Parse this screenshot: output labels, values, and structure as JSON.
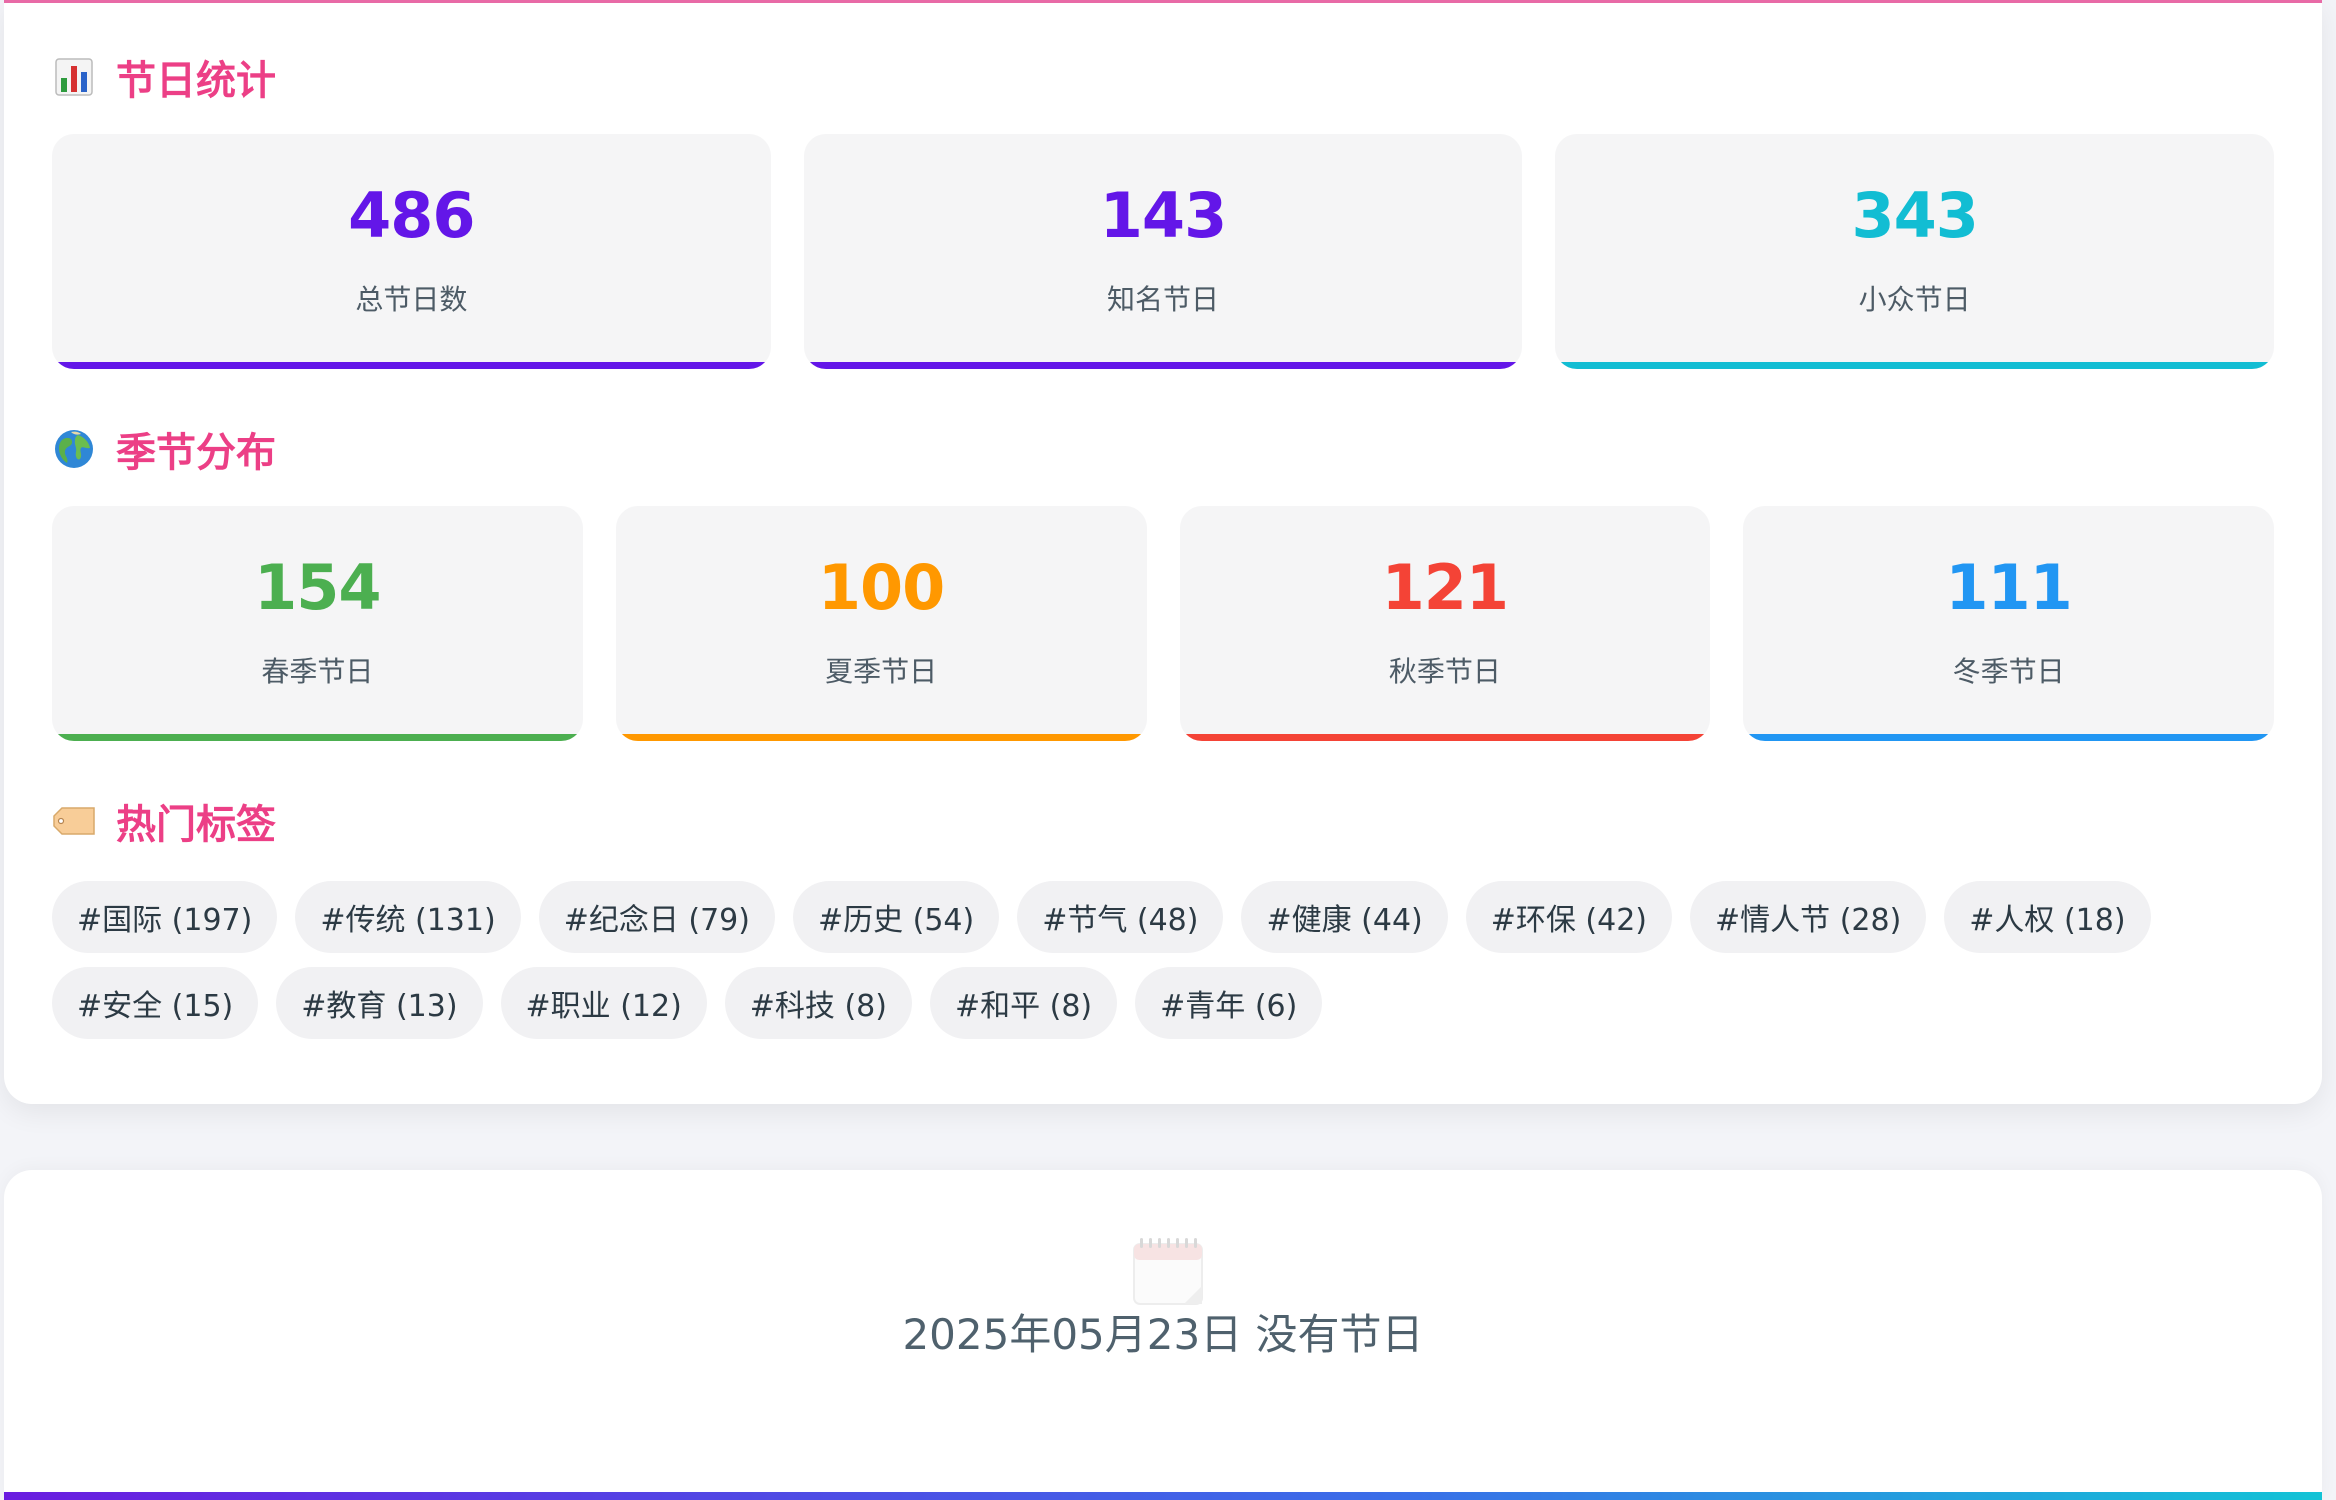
{
  "stats": {
    "title": "节日统计",
    "icon": "bar-chart-icon",
    "cards": [
      {
        "value": "486",
        "label": "总节日数",
        "color": "#6316e8"
      },
      {
        "value": "143",
        "label": "知名节日",
        "color": "#6316e8"
      },
      {
        "value": "343",
        "label": "小众节日",
        "color": "#12bdd3"
      }
    ]
  },
  "seasons": {
    "title": "季节分布",
    "icon": "globe-icon",
    "cards": [
      {
        "value": "154",
        "label": "春季节日",
        "color": "#4caf50"
      },
      {
        "value": "100",
        "label": "夏季节日",
        "color": "#ff9800"
      },
      {
        "value": "121",
        "label": "秋季节日",
        "color": "#f44336"
      },
      {
        "value": "111",
        "label": "冬季节日",
        "color": "#2196f3"
      }
    ]
  },
  "tags": {
    "title": "热门标签",
    "icon": "tag-icon",
    "items": [
      "#国际 (197)",
      "#传统 (131)",
      "#纪念日 (79)",
      "#历史 (54)",
      "#节气 (48)",
      "#健康 (44)",
      "#环保 (42)",
      "#情人节 (28)",
      "#人权 (18)",
      "#安全 (15)",
      "#教育 (13)",
      "#职业 (12)",
      "#科技 (8)",
      "#和平 (8)",
      "#青年 (6)"
    ]
  },
  "empty_state": {
    "icon": "calendar-icon",
    "message": "2025年05月23日 没有节日"
  }
}
